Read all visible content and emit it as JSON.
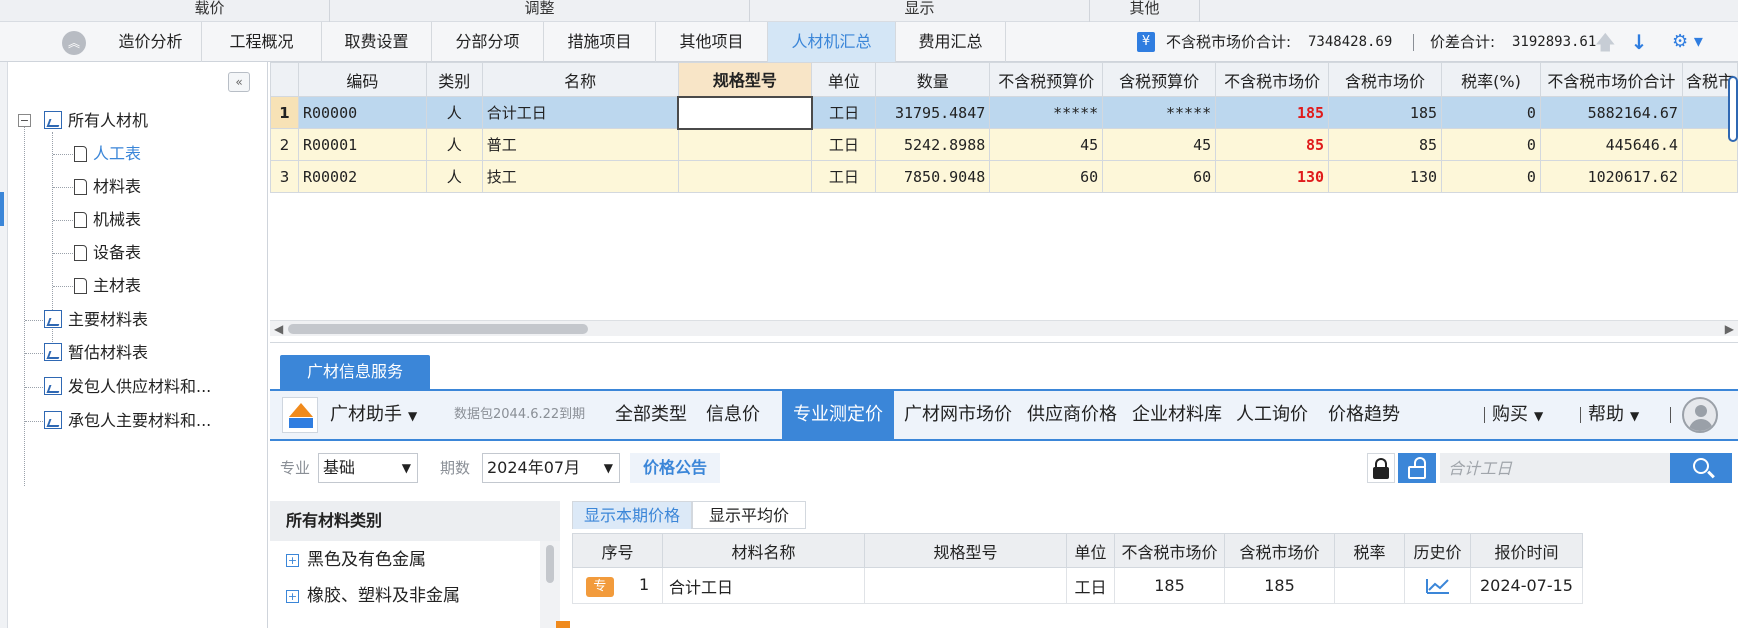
{
  "ribbon_groups": [
    "载价",
    "调整",
    "显示",
    "其他"
  ],
  "tabs": [
    {
      "label": "造价分析"
    },
    {
      "label": "工程概况"
    },
    {
      "label": "取费设置"
    },
    {
      "label": "分部分项"
    },
    {
      "label": "措施项目"
    },
    {
      "label": "其他项目"
    },
    {
      "label": "人材机汇总",
      "active": true
    },
    {
      "label": "费用汇总"
    }
  ],
  "summary": {
    "market_total_label": "不含税市场价合计:",
    "market_total_value": "7348428.69",
    "diff_total_label": "价差合计:",
    "diff_total_value": "3192893.61"
  },
  "tree": {
    "root": "所有人材机",
    "children": [
      "人工表",
      "材料表",
      "机械表",
      "设备表",
      "主材表"
    ],
    "others": [
      "主要材料表",
      "暂估材料表",
      "发包人供应材料和...",
      "承包人主要材料和..."
    ]
  },
  "grid": {
    "columns": [
      "编码",
      "类别",
      "名称",
      "规格型号",
      "单位",
      "数量",
      "不含税预算价",
      "含税预算价",
      "不含税市场价",
      "含税市场价",
      "税率(%)",
      "不含税市场价合计",
      "含税市"
    ],
    "rows": [
      {
        "n": "1",
        "code": "R00000",
        "type": "人",
        "name": "合计工日",
        "spec": "",
        "unit": "工日",
        "qty": "31795.4847",
        "budget_ex": "*****",
        "budget_in": "*****",
        "market_ex": "185",
        "market_in": "185",
        "tax": "0",
        "total_ex": "5882164.67"
      },
      {
        "n": "2",
        "code": "R00001",
        "type": "人",
        "name": "普工",
        "spec": "",
        "unit": "工日",
        "qty": "5242.8988",
        "budget_ex": "45",
        "budget_in": "45",
        "market_ex": "85",
        "market_in": "85",
        "tax": "0",
        "total_ex": "445646.4"
      },
      {
        "n": "3",
        "code": "R00002",
        "type": "人",
        "name": "技工",
        "spec": "",
        "unit": "工日",
        "qty": "7850.9048",
        "budget_ex": "60",
        "budget_in": "60",
        "market_ex": "130",
        "market_in": "130",
        "tax": "0",
        "total_ex": "1020617.62"
      }
    ]
  },
  "service": {
    "tab_label": "广材信息服务",
    "assistant_label": "广材助手",
    "package_note": "数据包2044.6.22到期",
    "nav": [
      "全部类型",
      "信息价",
      "专业测定价",
      "广材网市场价",
      "供应商价格",
      "企业材料库",
      "人工询价",
      "价格趋势"
    ],
    "active_nav": "专业测定价",
    "buy_label": "购买",
    "help_label": "帮助"
  },
  "filters": {
    "specialty_label": "专业",
    "specialty_value": "基础",
    "period_label": "期数",
    "period_value": "2024年07月",
    "notice_label": "价格公告",
    "search_placeholder": "合计工日"
  },
  "categories": {
    "header": "所有材料类别",
    "items": [
      "黑色及有色金属",
      "橡胶、塑料及非金属"
    ]
  },
  "price_tabs": [
    "显示本期价格",
    "显示平均价"
  ],
  "price_table": {
    "columns": [
      "序号",
      "材料名称",
      "规格型号",
      "单位",
      "不含税市场价",
      "含税市场价",
      "税率",
      "历史价",
      "报价时间"
    ],
    "rows": [
      {
        "badge": "专",
        "seq": "1",
        "name": "合计工日",
        "spec": "",
        "unit": "工日",
        "market_ex": "185",
        "market_in": "185",
        "tax": "",
        "date": "2024-07-15"
      }
    ]
  },
  "colors": {
    "accent": "#3b86d8",
    "highlight_red": "#e01b1b",
    "row_yellow": "#fdf7d9",
    "row_selected": "#bcd7ee"
  },
  "icons": [
    "collapse-up-icon",
    "yen-icon",
    "arrow-up-icon",
    "arrow-down-icon",
    "settings-icon",
    "panel-collapse-icon",
    "lock-icon",
    "unlock-icon",
    "search-icon",
    "trend-icon",
    "avatar"
  ]
}
